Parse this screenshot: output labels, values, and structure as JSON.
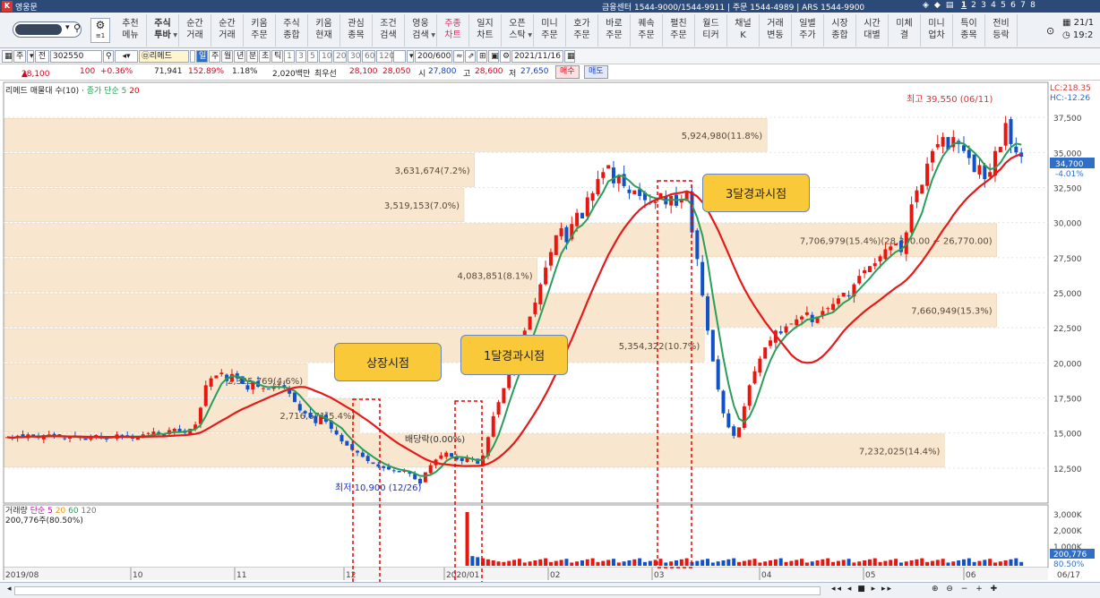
{
  "window": {
    "title": "영웅문",
    "center_info": "금융센터 1544-9000/1544-9911 | 주문 1544-4989 | ARS 1544-9900",
    "screen_nums": [
      "1",
      "2",
      "3",
      "4",
      "5",
      "6",
      "7",
      "8"
    ],
    "active_screen": "1"
  },
  "toolbar": {
    "settings_label": "≡1",
    "menu": [
      {
        "l1": "추천",
        "l2": "메뉴"
      },
      {
        "l1": "주식",
        "l2": "투바"
      },
      {
        "l1": "순간",
        "l2": "거래"
      },
      {
        "l1": "순간",
        "l2": "거래"
      },
      {
        "l1": "키움",
        "l2": "주문"
      },
      {
        "l1": "주식",
        "l2": "종합"
      },
      {
        "l1": "키움",
        "l2": "현재"
      },
      {
        "l1": "관심",
        "l2": "종목"
      },
      {
        "l1": "조건",
        "l2": "검색"
      },
      {
        "l1": "영웅",
        "l2": "검색"
      },
      {
        "l1": "주종",
        "l2": "차트"
      },
      {
        "l1": "일지",
        "l2": "차트"
      },
      {
        "l1": "오픈",
        "l2": "스탁"
      },
      {
        "l1": "미니",
        "l2": "주문"
      },
      {
        "l1": "호가",
        "l2": "주문"
      },
      {
        "l1": "바로",
        "l2": "주문"
      },
      {
        "l1": "퀘속",
        "l2": "주문"
      },
      {
        "l1": "펼친",
        "l2": "주문"
      },
      {
        "l1": "월드",
        "l2": "티커"
      },
      {
        "l1": "채널",
        "l2": "K"
      },
      {
        "l1": "거래",
        "l2": "변동"
      },
      {
        "l1": "일별",
        "l2": "주가"
      },
      {
        "l1": "시장",
        "l2": "종합"
      },
      {
        "l1": "시간",
        "l2": "대별"
      },
      {
        "l1": "미체",
        "l2": "결"
      },
      {
        "l1": "미니",
        "l2": "업차"
      },
      {
        "l1": "특이",
        "l2": "종목"
      },
      {
        "l1": "전비",
        "l2": "등락"
      }
    ],
    "date_short": "21/1",
    "time_short": "19:2"
  },
  "controls": {
    "code": "302550",
    "name": "리메드",
    "periods": [
      "일",
      "주",
      "월",
      "년",
      "분",
      "초",
      "틱"
    ],
    "intervals": [
      "1",
      "3",
      "5",
      "10",
      "20",
      "30",
      "60",
      "120"
    ],
    "count": "200/600",
    "date": "2021/11/16",
    "jeon": "전",
    "ju": "주"
  },
  "quote": {
    "price": "28,100",
    "arrow": "▲",
    "change": "100",
    "pct": "+0.36%",
    "volume": "71,941",
    "vol_ratio": "152.89%",
    "turnover_rate": "1.18%",
    "amount": "2,020백만",
    "best_label": "최우선",
    "ask": "28,100",
    "bid": "28,050",
    "open_lbl": "시",
    "open": "27,800",
    "high_lbl": "고",
    "high": "28,600",
    "low_lbl": "저",
    "low": "27,650",
    "buy": "매수",
    "sell": "매도"
  },
  "legend": {
    "name": "리메드 매물대 수(10)",
    "ma_label": "종가 단순",
    "ma1": "5",
    "ma2": "20"
  },
  "volume_legend": {
    "label": "거래량",
    "type": "단순",
    "ma": [
      "5",
      "20",
      "60",
      "120"
    ],
    "value": "200,776주(80.50%)"
  },
  "right_info": {
    "lc": "LC:218.35",
    "hc": "HC:-12.26",
    "price_badge": "34,700",
    "pct_badge": "-4.01%",
    "vol_badge": "200,776",
    "volpct_badge": "80.50%"
  },
  "annotations": {
    "max": "최고 39,550 (06/11)",
    "min": "최저 10,900 (12/26)",
    "dividend": "배당락(0.00%)",
    "callouts": [
      "상장시점",
      "1달경과시점",
      "3달경과시점"
    ]
  },
  "bottom": {
    "range": "06/17"
  },
  "chart_data": {
    "type": "candlestick",
    "y_ticks": [
      12500,
      15000,
      17500,
      20000,
      22500,
      25000,
      27500,
      30000,
      32500,
      35000,
      37500
    ],
    "ylim": [
      10000,
      40000
    ],
    "x_ticks": [
      "2019/08",
      "10",
      "11",
      "12",
      "2020/01",
      "02",
      "03",
      "04",
      "05",
      "06"
    ],
    "volume_ticks": [
      "3,000K",
      "2,000K",
      "1,000K"
    ],
    "profile": [
      {
        "label": "5,924,980(11.8%)",
        "lo": 35000,
        "hi": 37500,
        "width": 0.73
      },
      {
        "label": "3,631,674(7.2%)",
        "lo": 32500,
        "hi": 35000,
        "width": 0.45
      },
      {
        "label": "3,519,153(7.0%)",
        "lo": 30000,
        "hi": 32500,
        "width": 0.44
      },
      {
        "label": "7,706,979(15.4%)(28,390.00 ~ 26,770.00)",
        "lo": 27500,
        "hi": 30000,
        "width": 0.95
      },
      {
        "label": "4,083,851(8.1%)",
        "lo": 25000,
        "hi": 27500,
        "width": 0.51
      },
      {
        "label": "7,660,949(15.3%)",
        "lo": 22500,
        "hi": 25000,
        "width": 0.95
      },
      {
        "label": "5,354,322(10.7%)",
        "lo": 20000,
        "hi": 22500,
        "width": 0.67
      },
      {
        "label": "2,325,769(4.6%)",
        "lo": 17500,
        "hi": 20000,
        "width": 0.29
      },
      {
        "label": "2,716,671(5.4%)",
        "lo": 15000,
        "hi": 17500,
        "width": 0.34
      },
      {
        "label": "7,232,025(14.4%)",
        "lo": 12500,
        "hi": 15000,
        "width": 0.9
      }
    ],
    "prices": [
      14700,
      14600,
      14800,
      14700,
      14900,
      14750,
      14650,
      14850,
      14900,
      14800,
      14700,
      14600,
      14750,
      14800,
      14650,
      14500,
      14700,
      14850,
      14600,
      14550,
      14700,
      14900,
      14800,
      14700,
      14600,
      14750,
      14900,
      15000,
      15100,
      14900,
      14800,
      15200,
      15300,
      15100,
      15000,
      15300,
      15600,
      16800,
      18400,
      18900,
      19100,
      19300,
      18700,
      19200,
      18900,
      18500,
      18100,
      18600,
      18300,
      18200,
      18100,
      18300,
      18500,
      18200,
      17800,
      17200,
      16600,
      16400,
      16100,
      15700,
      16300,
      15800,
      15300,
      14900,
      14400,
      14100,
      13800,
      13600,
      13300,
      13000,
      12800,
      12600,
      12500,
      12400,
      12300,
      12200,
      12300,
      12100,
      11700,
      11400,
      12200,
      12700,
      13100,
      13400,
      13600,
      13300,
      13100,
      13000,
      13200,
      13100,
      12800,
      13400,
      14700,
      16200,
      17200,
      18200,
      19300,
      20200,
      21300,
      22300,
      23300,
      24300,
      25600,
      26800,
      27900,
      29100,
      29600,
      28600,
      29900,
      30700,
      30300,
      31800,
      32100,
      33100,
      33600,
      34100,
      32800,
      33300,
      32600,
      32100,
      32300,
      31900,
      31600,
      31400,
      31500,
      32100,
      31300,
      31900,
      31200,
      31700,
      32200,
      29300,
      27400,
      24800,
      22300,
      20100,
      18100,
      16400,
      15400,
      14800,
      15400,
      16900,
      18400,
      19400,
      20300,
      21100,
      21600,
      22300,
      22100,
      22600,
      22800,
      23100,
      23300,
      23600,
      22900,
      23300,
      23700,
      23900,
      24200,
      24600,
      25000,
      24800,
      25600,
      26200,
      26600,
      26900,
      27100,
      27600,
      28100,
      28300,
      28500,
      27900,
      29300,
      31300,
      32300,
      32700,
      34200,
      35100,
      35600,
      36100,
      35200,
      36100,
      35600,
      35100,
      34600,
      33600,
      34100,
      33100,
      33600,
      35100,
      35400,
      37100,
      35600,
      35000,
      34700
    ],
    "vol_spike_index": 88
  }
}
